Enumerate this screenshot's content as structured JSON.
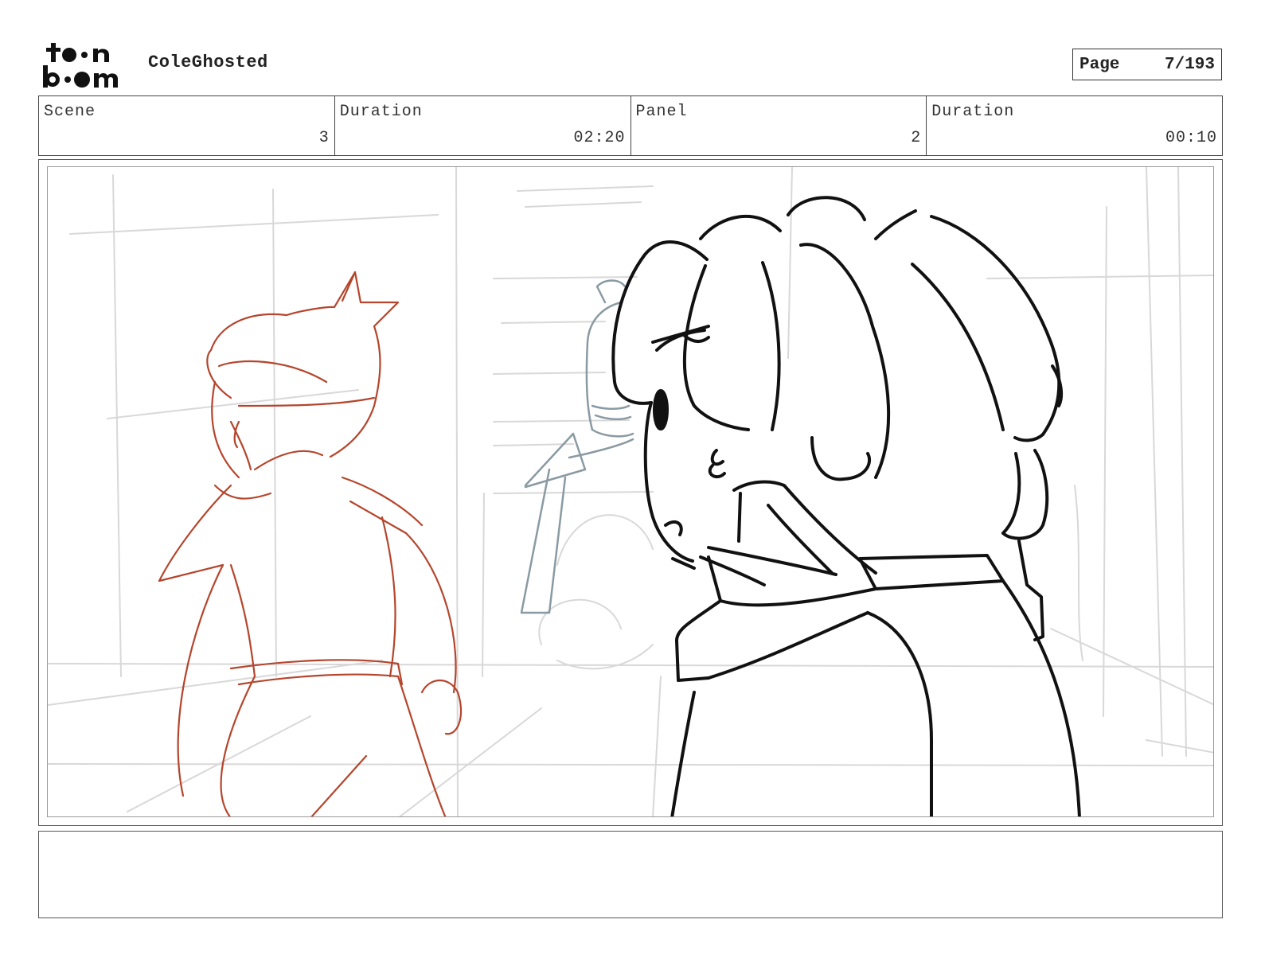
{
  "header": {
    "logo_top": "toon",
    "logo_bottom": "boom",
    "project_title": "ColeGhosted",
    "page_label": "Page",
    "page_number": "7/193"
  },
  "info": {
    "scene_label": "Scene",
    "scene_value": "3",
    "scene_duration_label": "Duration",
    "scene_duration_value": "02:20",
    "panel_label": "Panel",
    "panel_value": "2",
    "panel_duration_label": "Duration",
    "panel_duration_value": "00:10"
  },
  "notes": {
    "text": ""
  },
  "colors": {
    "background_sketch": "#d8d8d8",
    "ghost_sketch": "#8a9aa3",
    "red_character": "#b5452c",
    "main_character": "#111111"
  },
  "icons": [
    "toon-boom-logo"
  ]
}
